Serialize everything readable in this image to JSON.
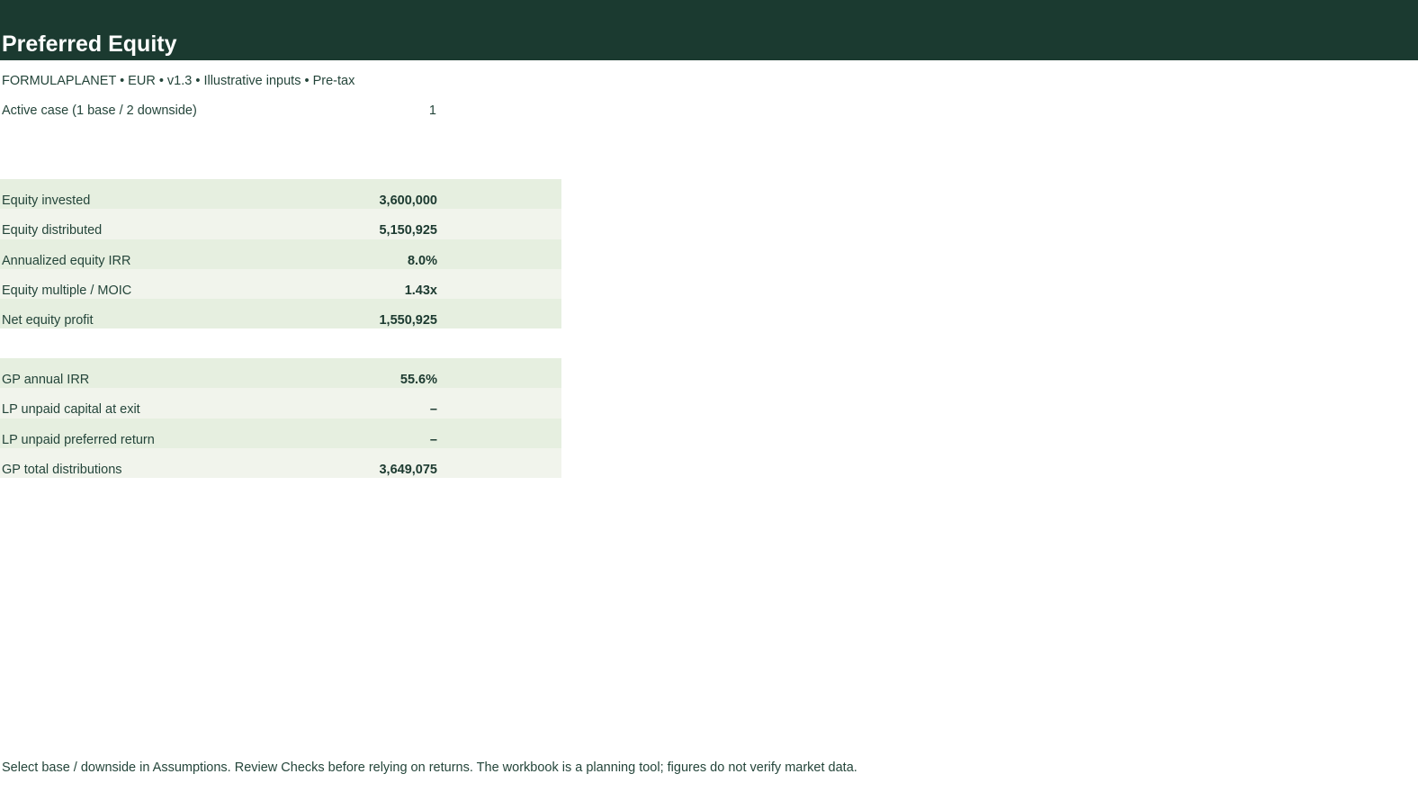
{
  "header": {
    "title": "Preferred Equity",
    "subtitle": "FORMULAPLANET  •  EUR  •  v1.3  •  Illustrative inputs  •  Pre-tax",
    "background": "#1b3a30"
  },
  "case_selector": {
    "label": "Active case (1 base / 2 downside)",
    "value": "1"
  },
  "equity_summary": [
    {
      "label": "Equity invested",
      "value": "3,600,000"
    },
    {
      "label": "Equity distributed",
      "value": "5,150,925"
    },
    {
      "label": "Annualized equity IRR",
      "value": "8.0%"
    },
    {
      "label": "Equity multiple / MOIC",
      "value": "1.43x"
    },
    {
      "label": "Net equity profit",
      "value": "1,550,925"
    }
  ],
  "waterfall_summary": [
    {
      "label": "GP annual IRR",
      "value": "55.6%"
    },
    {
      "label": "LP unpaid capital at exit",
      "value": "–"
    },
    {
      "label": "LP unpaid preferred return",
      "value": "–"
    },
    {
      "label": "GP total distributions",
      "value": "3,649,075"
    }
  ],
  "footer": {
    "note": "Select base / downside in Assumptions. Review Checks before relying on returns. The workbook is a planning tool; figures do not verify market data."
  },
  "colors": {
    "row_alt_1": "#e6efe0",
    "row_alt_2": "#f1f4ec",
    "text": "#24453a"
  }
}
